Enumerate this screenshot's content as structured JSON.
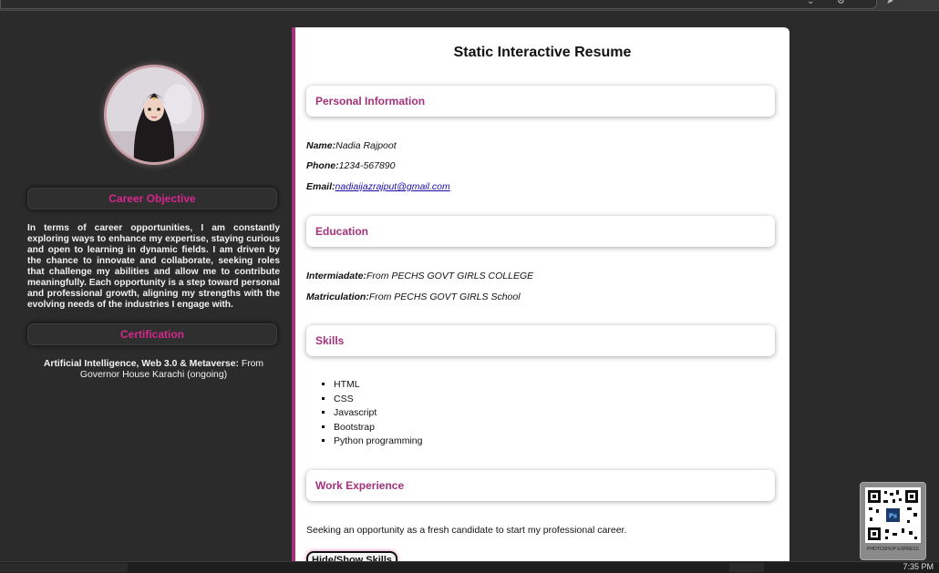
{
  "resume": {
    "title": "Static Interactive Resume",
    "personal": {
      "heading": "Personal Information",
      "name_label": "Name:",
      "name": "Nadia Rajpoot",
      "phone_label": "Phone:",
      "phone": "1234-567890",
      "email_label": "Email:",
      "email": "nadiaijazrajput@gmail.com"
    },
    "education": {
      "heading": "Education",
      "inter_label": "Intermiadate:",
      "inter": "From PECHS GOVT GIRLS COLLEGE",
      "matric_label": "Matriculation:",
      "matric": "From PECHS GOVT GIRLS School"
    },
    "skills": {
      "heading": "Skills",
      "items": [
        "HTML",
        "CSS",
        "Javascript",
        "Bootstrap",
        "Python programming"
      ]
    },
    "work": {
      "heading": "Work Experience",
      "text": "Seeking an opportunity as a fresh candidate to start my professional career."
    },
    "toggle_button": "Hide/Show Skills"
  },
  "sidebar": {
    "career_heading": "Career Objective",
    "career_text": "In terms of career opportunities, I am constantly exploring ways to enhance my expertise, staying curious and open to learning in dynamic fields. I am driven by the chance to innovate and collaborate, seeking roles that challenge my abilities and allow me to contribute meaningfully. Each opportunity is a step toward personal and professional growth, aligning my strengths with the evolving needs of the industries I engage with.",
    "cert_heading": "Certification",
    "cert_title": "Artificial Intelligence, Web 3.0 & Metaverse:",
    "cert_text": "From Governor House Karachi (ongoing)"
  },
  "widget": {
    "caption": "PHOTOSHOP EXPRESS"
  },
  "taskbar": {
    "time": "7:35 PM"
  },
  "colors": {
    "accent": "#d6278c",
    "border": "#a4317c",
    "background": "#2b2b2b"
  },
  "icons": [
    "minimize-icon",
    "close-icon",
    "qr-code-icon",
    "photoshop-icon"
  ]
}
